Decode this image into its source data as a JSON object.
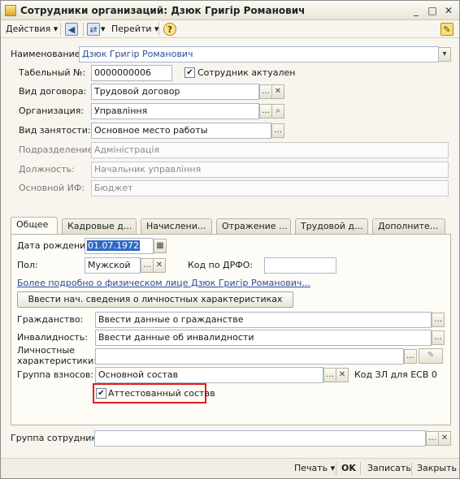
{
  "window": {
    "title": "Сотрудники организаций: Дзюк Григір Романович",
    "icon": "app-icon"
  },
  "toolbar": {
    "actions_label": "Действия",
    "goto_label": "Перейти",
    "help_icon": "?"
  },
  "form": {
    "name_label": "Наименование:",
    "name_value": "Дзюк Григір Романович",
    "tab_no_label": "Табельный №:",
    "tab_no_value": "0000000006",
    "active_label": "Сотрудник актуален",
    "active_checked": true,
    "contract_label": "Вид договора:",
    "contract_value": "Трудовой договор",
    "org_label": "Организация:",
    "org_value": "Управління",
    "employment_label": "Вид занятости:",
    "employment_value": "Основное место работы",
    "division_label": "Подразделение:",
    "division_value": "Адміністрація",
    "position_label": "Должность:",
    "position_value": "Начальник управління",
    "fund_label": "Основной ИФ:",
    "fund_value": "Бюджет"
  },
  "tabs": [
    {
      "label": "Общее"
    },
    {
      "label": "Кадровые д..."
    },
    {
      "label": "Начислени..."
    },
    {
      "label": "Отражение ..."
    },
    {
      "label": "Трудовой д..."
    },
    {
      "label": "Дополните..."
    }
  ],
  "general": {
    "birth_label": "Дата рождения:",
    "birth_value": "01.07.1972",
    "sex_label": "Пол:",
    "sex_value": "Мужской",
    "drfo_label": "Код по ДРФО:",
    "drfo_value": "",
    "person_link": "Более подробно о физическом лице Дзюк Григір Романович...",
    "enter_btn": "Ввести нач. сведения о личностных характеристиках",
    "citizenship_label": "Гражданство:",
    "citizenship_value": "Ввести данные о гражданстве",
    "disability_label": "Инвалидность:",
    "disability_value": "Ввести данные об инвалидности",
    "personal_label_1": "Личностные",
    "personal_label_2": "характеристики:",
    "personal_value": "",
    "contrib_label": "Группа взносов:",
    "contrib_value": "Основной состав",
    "zl_code_label": "Код ЗЛ для ЕСВ 0",
    "certified_label": "Аттестованный состав",
    "certified_checked": true
  },
  "group": {
    "label": "Группа сотрудника:",
    "value": ""
  },
  "footer": {
    "print_label": "Печать",
    "ok_label": "OK",
    "save_label": "Записать",
    "close_label": "Закрыть"
  },
  "colors": {
    "highlight_border": "#e02020",
    "link": "#2b4d97",
    "selection": "#316ac5"
  }
}
